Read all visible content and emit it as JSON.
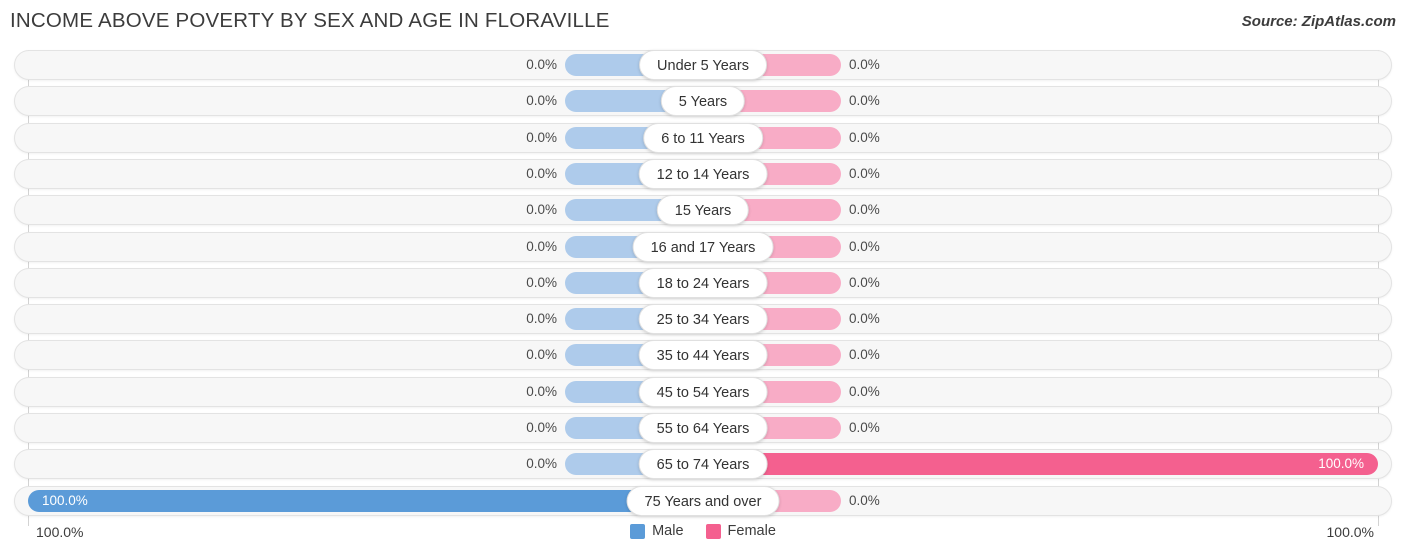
{
  "header": {
    "title": "INCOME ABOVE POVERTY BY SEX AND AGE IN FLORAVILLE",
    "source": "Source: ZipAtlas.com"
  },
  "legend": {
    "male_label": "Male",
    "female_label": "Female",
    "male_color": "#5b9bd8",
    "female_color": "#f4608f",
    "male_muted_color": "#aecbeb",
    "female_muted_color": "#f8acc6"
  },
  "axis": {
    "left_label": "100.0%",
    "right_label": "100.0%",
    "max": 100.0
  },
  "chart_data": {
    "type": "bar",
    "title": "INCOME ABOVE POVERTY BY SEX AND AGE IN FLORAVILLE",
    "subtitle": "Source: ZipAtlas.com",
    "orientation": "horizontal-diverging",
    "xlabel": "",
    "ylabel": "",
    "xlim": [
      100.0,
      100.0
    ],
    "grid": false,
    "legend_position": "bottom-center",
    "categories": [
      "Under 5 Years",
      "5 Years",
      "6 to 11 Years",
      "12 to 14 Years",
      "15 Years",
      "16 and 17 Years",
      "18 to 24 Years",
      "25 to 34 Years",
      "35 to 44 Years",
      "45 to 54 Years",
      "55 to 64 Years",
      "65 to 74 Years",
      "75 Years and over"
    ],
    "series": [
      {
        "name": "Male",
        "side": "left",
        "values": [
          0.0,
          0.0,
          0.0,
          0.0,
          0.0,
          0.0,
          0.0,
          0.0,
          0.0,
          0.0,
          0.0,
          0.0,
          100.0
        ],
        "labels": [
          "0.0%",
          "0.0%",
          "0.0%",
          "0.0%",
          "0.0%",
          "0.0%",
          "0.0%",
          "0.0%",
          "0.0%",
          "0.0%",
          "0.0%",
          "0.0%",
          "100.0%"
        ]
      },
      {
        "name": "Female",
        "side": "right",
        "values": [
          0.0,
          0.0,
          0.0,
          0.0,
          0.0,
          0.0,
          0.0,
          0.0,
          0.0,
          0.0,
          0.0,
          100.0,
          0.0
        ],
        "labels": [
          "0.0%",
          "0.0%",
          "0.0%",
          "0.0%",
          "0.0%",
          "0.0%",
          "0.0%",
          "0.0%",
          "0.0%",
          "0.0%",
          "0.0%",
          "100.0%",
          "0.0%"
        ]
      }
    ]
  }
}
